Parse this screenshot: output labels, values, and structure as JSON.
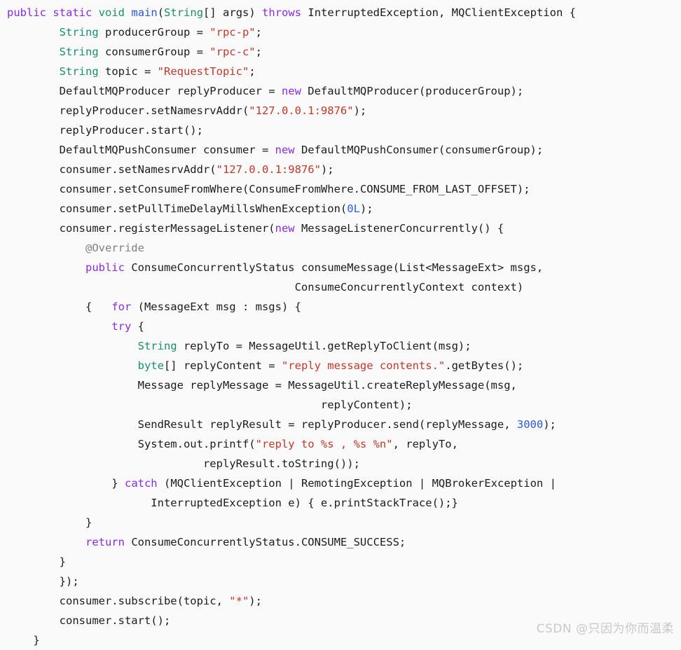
{
  "editor": {
    "language": "java",
    "background_color": "#fafafa",
    "default_text_color": "#1c1c1c",
    "font_size_px": 15.5,
    "line_height_px": 28,
    "theme_colors": {
      "keyword": "#8a2be2",
      "type": "#1a8f6e",
      "method_declaration": "#2a5bd7",
      "string_literal": "#c0392b",
      "number_literal": "#2a5bd7",
      "annotation": "#808080",
      "plain": "#1c1c1c"
    }
  },
  "code": {
    "lines": [
      [
        {
          "t": "public",
          "c": "kw"
        },
        {
          "t": " ",
          "c": "plain"
        },
        {
          "t": "static",
          "c": "kw"
        },
        {
          "t": " ",
          "c": "plain"
        },
        {
          "t": "void",
          "c": "type"
        },
        {
          "t": " ",
          "c": "plain"
        },
        {
          "t": "main",
          "c": "fn"
        },
        {
          "t": "(",
          "c": "punct"
        },
        {
          "t": "String",
          "c": "type"
        },
        {
          "t": "[] args) ",
          "c": "plain"
        },
        {
          "t": "throws",
          "c": "kw"
        },
        {
          "t": " InterruptedException, MQClientException {",
          "c": "plain"
        }
      ],
      [
        {
          "t": "        ",
          "c": "plain"
        },
        {
          "t": "String",
          "c": "type"
        },
        {
          "t": " producerGroup = ",
          "c": "plain"
        },
        {
          "t": "\"rpc-p\"",
          "c": "str"
        },
        {
          "t": ";",
          "c": "plain"
        }
      ],
      [
        {
          "t": "        ",
          "c": "plain"
        },
        {
          "t": "String",
          "c": "type"
        },
        {
          "t": " consumerGroup = ",
          "c": "plain"
        },
        {
          "t": "\"rpc-c\"",
          "c": "str"
        },
        {
          "t": ";",
          "c": "plain"
        }
      ],
      [
        {
          "t": "        ",
          "c": "plain"
        },
        {
          "t": "String",
          "c": "type"
        },
        {
          "t": " topic = ",
          "c": "plain"
        },
        {
          "t": "\"RequestTopic\"",
          "c": "str"
        },
        {
          "t": ";",
          "c": "plain"
        }
      ],
      [
        {
          "t": "        DefaultMQProducer replyProducer = ",
          "c": "plain"
        },
        {
          "t": "new",
          "c": "kw"
        },
        {
          "t": " DefaultMQProducer(producerGroup);",
          "c": "plain"
        }
      ],
      [
        {
          "t": "        replyProducer.setNamesrvAddr(",
          "c": "plain"
        },
        {
          "t": "\"127.0.0.1:9876\"",
          "c": "str"
        },
        {
          "t": ");",
          "c": "plain"
        }
      ],
      [
        {
          "t": "        replyProducer.start();",
          "c": "plain"
        }
      ],
      [
        {
          "t": "        DefaultMQPushConsumer consumer = ",
          "c": "plain"
        },
        {
          "t": "new",
          "c": "kw"
        },
        {
          "t": " DefaultMQPushConsumer(consumerGroup);",
          "c": "plain"
        }
      ],
      [
        {
          "t": "        consumer.setNamesrvAddr(",
          "c": "plain"
        },
        {
          "t": "\"127.0.0.1:9876\"",
          "c": "str"
        },
        {
          "t": ");",
          "c": "plain"
        }
      ],
      [
        {
          "t": "        consumer.setConsumeFromWhere(ConsumeFromWhere.CONSUME_FROM_LAST_OFFSET);",
          "c": "plain"
        }
      ],
      [
        {
          "t": "        consumer.setPullTimeDelayMillsWhenException(",
          "c": "plain"
        },
        {
          "t": "0L",
          "c": "num"
        },
        {
          "t": ");",
          "c": "plain"
        }
      ],
      [
        {
          "t": "        consumer.registerMessageListener(",
          "c": "plain"
        },
        {
          "t": "new",
          "c": "kw"
        },
        {
          "t": " MessageListenerConcurrently() {",
          "c": "plain"
        }
      ],
      [
        {
          "t": "            ",
          "c": "plain"
        },
        {
          "t": "@Override",
          "c": "anno"
        }
      ],
      [
        {
          "t": "            ",
          "c": "plain"
        },
        {
          "t": "public",
          "c": "kw"
        },
        {
          "t": " ConsumeConcurrentlyStatus consumeMessage(List<MessageExt> msgs,",
          "c": "plain"
        }
      ],
      [
        {
          "t": "                                            ConsumeConcurrentlyContext context)",
          "c": "plain"
        }
      ],
      [
        {
          "t": "            {   ",
          "c": "plain"
        },
        {
          "t": "for",
          "c": "kw"
        },
        {
          "t": " (MessageExt msg : msgs) {",
          "c": "plain"
        }
      ],
      [
        {
          "t": "                ",
          "c": "plain"
        },
        {
          "t": "try",
          "c": "kw"
        },
        {
          "t": " {",
          "c": "plain"
        }
      ],
      [
        {
          "t": "                    ",
          "c": "plain"
        },
        {
          "t": "String",
          "c": "type"
        },
        {
          "t": " replyTo = MessageUtil.getReplyToClient(msg);",
          "c": "plain"
        }
      ],
      [
        {
          "t": "                    ",
          "c": "plain"
        },
        {
          "t": "byte",
          "c": "type"
        },
        {
          "t": "[] replyContent = ",
          "c": "plain"
        },
        {
          "t": "\"reply message contents.\"",
          "c": "str"
        },
        {
          "t": ".getBytes();",
          "c": "plain"
        }
      ],
      [
        {
          "t": "                    Message replyMessage = MessageUtil.createReplyMessage(msg,",
          "c": "plain"
        }
      ],
      [
        {
          "t": "                                                replyContent);",
          "c": "plain"
        }
      ],
      [
        {
          "t": "                    SendResult replyResult = replyProducer.send(replyMessage, ",
          "c": "plain"
        },
        {
          "t": "3000",
          "c": "num"
        },
        {
          "t": ");",
          "c": "plain"
        }
      ],
      [
        {
          "t": "                    System.out.printf(",
          "c": "plain"
        },
        {
          "t": "\"reply to %s , %s %n\"",
          "c": "str"
        },
        {
          "t": ", replyTo,",
          "c": "plain"
        }
      ],
      [
        {
          "t": "                              replyResult.toString());",
          "c": "plain"
        }
      ],
      [
        {
          "t": "                } ",
          "c": "plain"
        },
        {
          "t": "catch",
          "c": "kw"
        },
        {
          "t": " (MQClientException | RemotingException | MQBrokerException |",
          "c": "plain"
        }
      ],
      [
        {
          "t": "                      InterruptedException e) { e.printStackTrace();}",
          "c": "plain"
        }
      ],
      [
        {
          "t": "            }",
          "c": "plain"
        }
      ],
      [
        {
          "t": "            ",
          "c": "plain"
        },
        {
          "t": "return",
          "c": "kw"
        },
        {
          "t": " ConsumeConcurrentlyStatus.CONSUME_SUCCESS;",
          "c": "plain"
        }
      ],
      [
        {
          "t": "        }",
          "c": "plain"
        }
      ],
      [
        {
          "t": "        });",
          "c": "plain"
        }
      ],
      [
        {
          "t": "        consumer.subscribe(topic, ",
          "c": "plain"
        },
        {
          "t": "\"*\"",
          "c": "str"
        },
        {
          "t": ");",
          "c": "plain"
        }
      ],
      [
        {
          "t": "        consumer.start();",
          "c": "plain"
        }
      ],
      [
        {
          "t": "    }",
          "c": "plain"
        }
      ]
    ]
  },
  "watermark": {
    "text": "CSDN @只因为你而温柔",
    "color": "#c9c9c9"
  }
}
